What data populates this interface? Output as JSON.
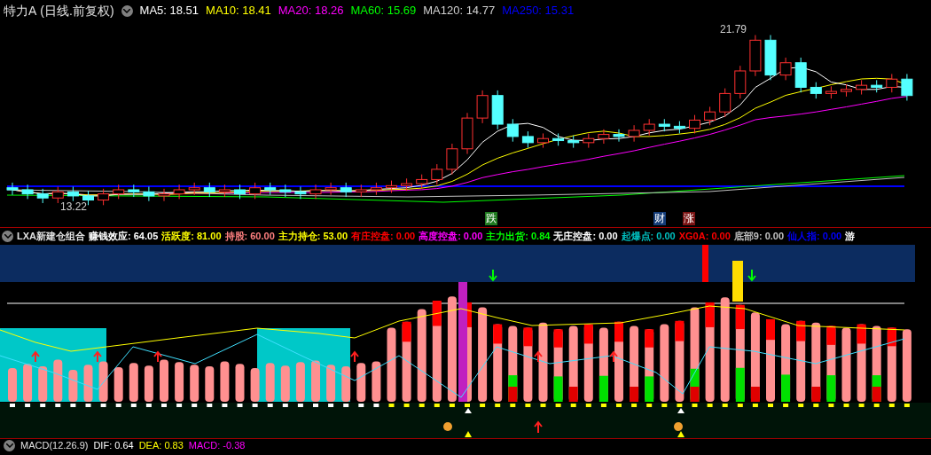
{
  "header": {
    "title": "特力A",
    "mode": "(日线.前复权)",
    "indicators": [
      {
        "label": "MA5: 18.51",
        "color": "#ffffff"
      },
      {
        "label": "MA10: 18.41",
        "color": "#ffff00"
      },
      {
        "label": "MA20: 18.26",
        "color": "#ff00ff"
      },
      {
        "label": "MA60: 15.69",
        "color": "#00ff00"
      },
      {
        "label": "MA120: 14.77",
        "color": "#d0d0d0"
      },
      {
        "label": "MA250: 15.31",
        "color": "#0000ff"
      }
    ]
  },
  "price_chart": {
    "high_label": "21.79",
    "low_label": "13.22"
  },
  "event_badges": [
    {
      "text": "跌",
      "color": "#1f7a1f"
    },
    {
      "text": "财",
      "color": "#143c78"
    },
    {
      "text": "涨",
      "color": "#7a1414"
    }
  ],
  "indicator_header": {
    "title": "LXA新建仓组合",
    "values": [
      {
        "label": "赚钱效应: 64.05",
        "color": "#ffffff"
      },
      {
        "label": "活跃度: 81.00",
        "color": "#ffff00"
      },
      {
        "label": "持股: 60.00",
        "color": "#ff8080"
      },
      {
        "label": "主力持仓: 53.00",
        "color": "#ffff00"
      },
      {
        "label": "有庄控盘: 0.00",
        "color": "#ff0000"
      },
      {
        "label": "高度控盘: 0.00",
        "color": "#ff00ff"
      },
      {
        "label": "主力出货: 0.84",
        "color": "#00ff00"
      },
      {
        "label": "无庄控盘: 0.00",
        "color": "#ffffff"
      },
      {
        "label": "起爆点: 0.00",
        "color": "#00c0c0"
      },
      {
        "label": "XG0A: 0.00",
        "color": "#ff0000"
      },
      {
        "label": "底部9: 0.00",
        "color": "#c0c0c0"
      },
      {
        "label": "仙人指: 0.00",
        "color": "#0000ff"
      },
      {
        "label": "游",
        "color": "#ffffff"
      }
    ]
  },
  "macd_header": {
    "title": "MACD(12.26.9)",
    "values": [
      {
        "label": "DIF: 0.64",
        "color": "#ffffff"
      },
      {
        "label": "DEA: 0.83",
        "color": "#ffff00"
      },
      {
        "label": "MACD: -0.38",
        "color": "#ff00ff"
      }
    ]
  }
}
